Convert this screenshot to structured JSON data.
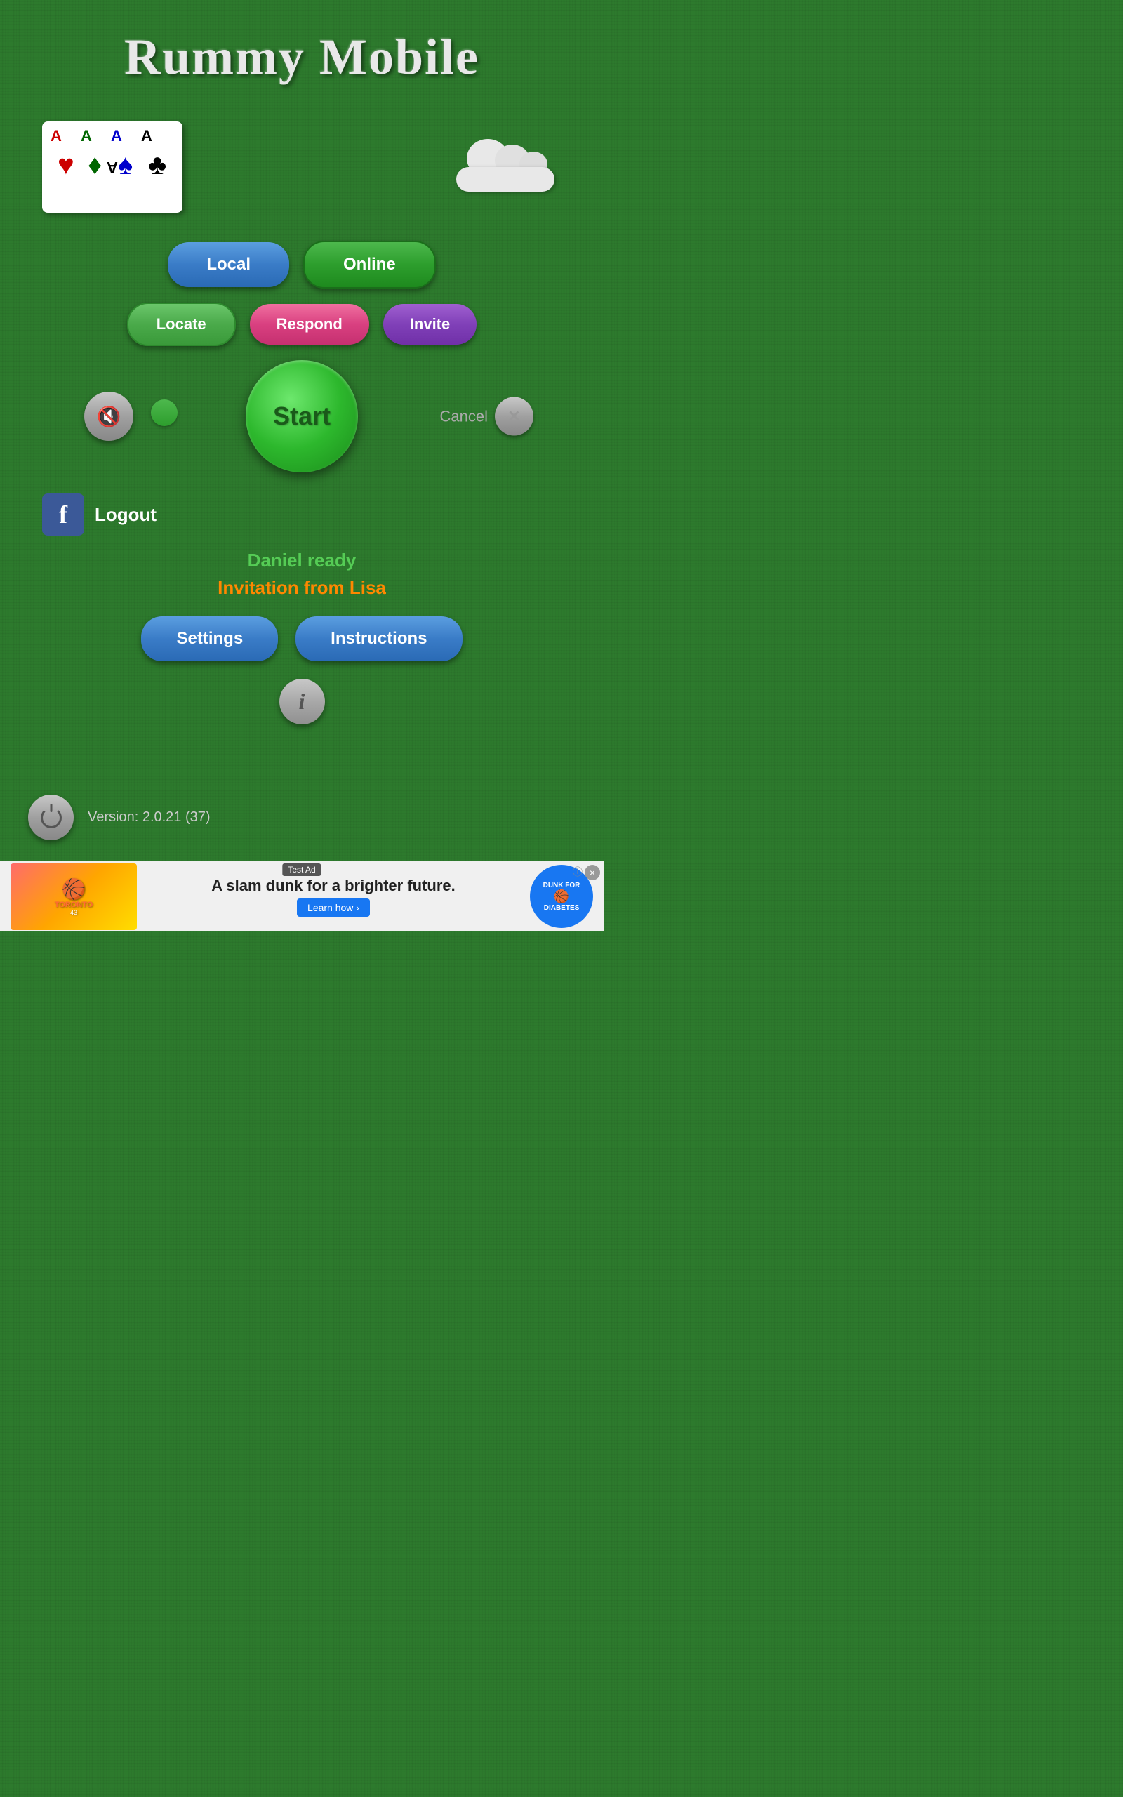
{
  "app": {
    "title": "Rummy Mobile"
  },
  "cards": {
    "suits": [
      "♥",
      "♦",
      "♠",
      "♣"
    ],
    "labels": [
      "A",
      "A",
      "A",
      "A"
    ],
    "colors": [
      "#cc0000",
      "#006600",
      "#0000cc",
      "#000000"
    ]
  },
  "cloud": {
    "visible": true
  },
  "mode_buttons": {
    "local": "Local",
    "online": "Online",
    "locate": "Locate",
    "respond": "Respond",
    "invite": "Invite"
  },
  "game_controls": {
    "start": "Start",
    "cancel": "Cancel"
  },
  "social": {
    "fb_letter": "f",
    "logout": "Logout"
  },
  "status": {
    "player_ready": "Daniel ready",
    "invitation": "Invitation from Lisa"
  },
  "action_buttons": {
    "settings": "Settings",
    "instructions": "Instructions"
  },
  "version": {
    "text": "Version: 2.0.21 (37)"
  },
  "ad": {
    "test_label": "Test Ad",
    "main_text": "A slam dunk for a brighter future.",
    "cta": "Learn how ›",
    "badge_line1": "DUNK FOR",
    "badge_line2": "DIABETES",
    "info": "ⓘ",
    "close": "×"
  }
}
